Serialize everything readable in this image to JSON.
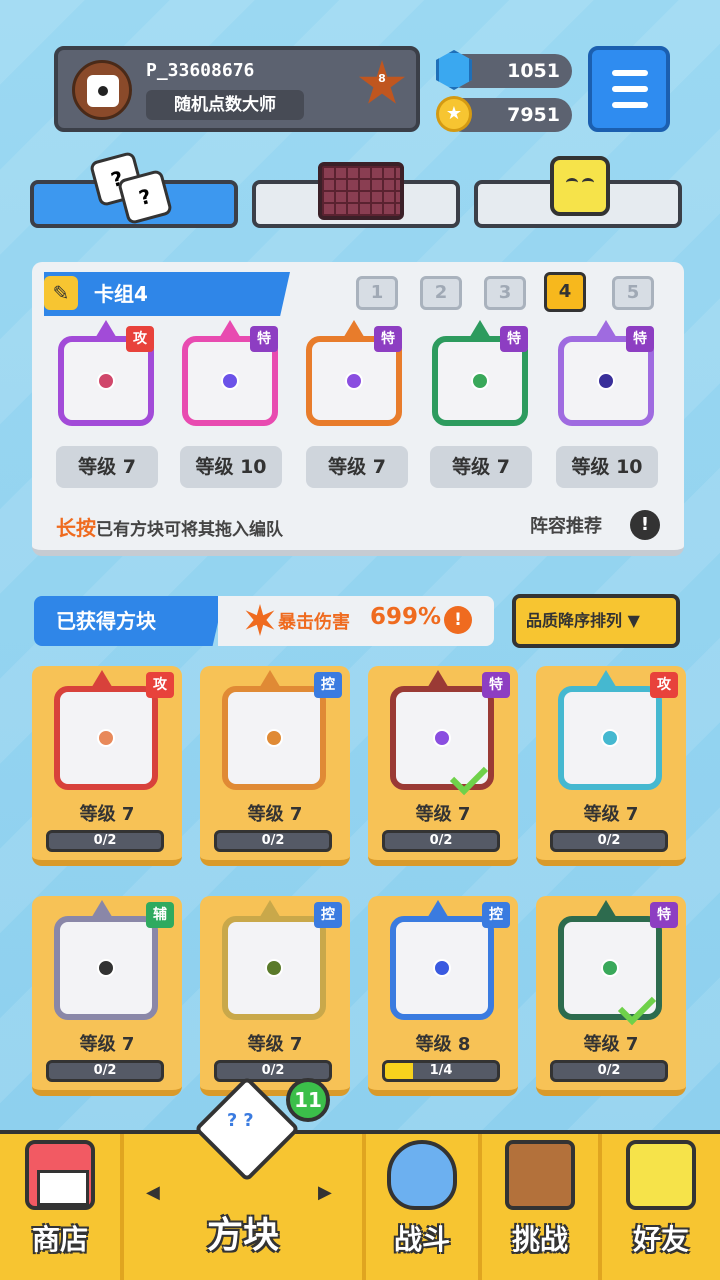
{
  "profile": {
    "username": "P_33608676",
    "title": "随机点数大师",
    "rank": "8"
  },
  "currency": {
    "gems": "1051",
    "coins": "7951"
  },
  "deck": {
    "title": "卡组4",
    "numbers": [
      "1",
      "2",
      "3",
      "4",
      "5"
    ],
    "active_number": "4",
    "cards": [
      {
        "tag": "攻",
        "level": "等级 7",
        "color": "#a24bd8",
        "dot": "#d0476b"
      },
      {
        "tag": "特",
        "level": "等级 10",
        "color": "#e84bb0",
        "dot": "#6b52e8"
      },
      {
        "tag": "特",
        "level": "等级 7",
        "color": "#e87c2b",
        "dot": "#8a4ee0"
      },
      {
        "tag": "特",
        "level": "等级 7",
        "color": "#2d9b5e",
        "dot": "#39a85a"
      },
      {
        "tag": "特",
        "level": "等级 10",
        "color": "#9f6be0",
        "dot": "#3a2f9a"
      }
    ],
    "hint_em": "长按",
    "hint_rest": "已有方块可将其拖入编队",
    "recommend": "阵容推荐",
    "info": "!"
  },
  "owned": {
    "title": "已获得方块",
    "crit_label": "暴击伤害",
    "crit_value": "699%",
    "crit_info": "!",
    "sort_label": "品质降序排列 ▼",
    "cards": [
      {
        "tag": "攻",
        "level": "等级 7",
        "progress": "0/2",
        "fill": 0,
        "color": "#d8413b",
        "dot": "#e8895a"
      },
      {
        "tag": "控",
        "level": "等级 7",
        "progress": "0/2",
        "fill": 0,
        "color": "#e08a35",
        "dot": "#e08a35"
      },
      {
        "tag": "特",
        "level": "等级 7",
        "progress": "0/2",
        "fill": 0,
        "color": "#9a3a35",
        "dot": "#8a4ee0"
      },
      {
        "tag": "攻",
        "level": "等级 7",
        "progress": "0/2",
        "fill": 0,
        "color": "#45b8d0",
        "dot": "#45b8d0"
      },
      {
        "tag": "辅",
        "level": "等级 7",
        "progress": "0/2",
        "fill": 0,
        "color": "#8a87a8",
        "dot": "#333333"
      },
      {
        "tag": "控",
        "level": "等级 7",
        "progress": "0/2",
        "fill": 0,
        "color": "#c9a84a",
        "dot": "#5a7a2a"
      },
      {
        "tag": "控",
        "level": "等级 8",
        "progress": "1/4",
        "fill": 0.25,
        "color": "#3a7be0",
        "dot": "#3a5ae0"
      },
      {
        "tag": "特",
        "level": "等级 7",
        "progress": "0/2",
        "fill": 0,
        "color": "#2d6b4e",
        "dot": "#39a85a"
      }
    ]
  },
  "nav": {
    "shop": "商店",
    "blocks": "方块",
    "battle": "战斗",
    "challenge": "挑战",
    "friends": "好友",
    "badge": "11",
    "arrow_left": "◀",
    "arrow_right": "▶"
  },
  "tab_dice_marks": [
    "?",
    "?"
  ]
}
